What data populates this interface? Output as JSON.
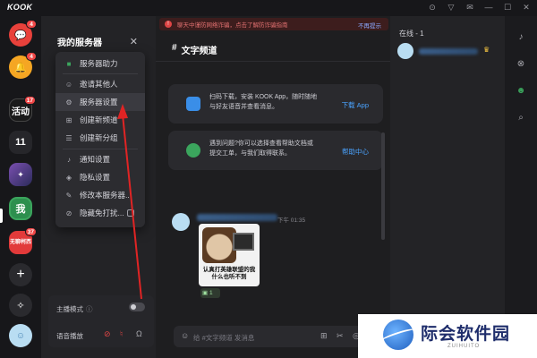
{
  "app": {
    "logo": "KOOK"
  },
  "window": {
    "controls": [
      "pin-icon",
      "shirt-icon",
      "mail-icon",
      "minimize-icon",
      "maximize-icon",
      "close-icon"
    ]
  },
  "servers": [
    {
      "icon": "chat-bubble-icon",
      "badge": "4",
      "color": "#e8413b"
    },
    {
      "icon": "bell-icon",
      "badge": "4",
      "color": "#f5a623"
    },
    {
      "label": "活动",
      "badge": "17",
      "color": "#1a1a1a"
    },
    {
      "label": "11",
      "badge": "",
      "color": "#26262a"
    },
    {
      "icon": "game-art-icon",
      "badge": "",
      "color": "#5a3d7a"
    },
    {
      "label": "我",
      "badge": "",
      "color": "#2d8f4e",
      "selected": true
    },
    {
      "label": "无聊柯西",
      "badge": "37",
      "color": "#e23a3a"
    },
    {
      "icon": "plus-icon",
      "badge": "",
      "color": "#2a2a2e"
    },
    {
      "icon": "compass-icon",
      "badge": "",
      "color": "#2a2a2e"
    }
  ],
  "sidebar": {
    "server_name": "我的服务器",
    "menu": [
      {
        "icon": "boost-icon",
        "label": "服务器助力"
      },
      {
        "icon": "invite-icon",
        "label": "邀请其他人"
      },
      {
        "icon": "settings-icon",
        "label": "服务器设置"
      },
      {
        "icon": "add-channel-icon",
        "label": "创建新频道"
      },
      {
        "icon": "add-group-icon",
        "label": "创建新分组"
      },
      {
        "icon": "bell-icon",
        "label": "通知设置"
      },
      {
        "icon": "shield-icon",
        "label": "隐私设置"
      },
      {
        "icon": "edit-icon",
        "label": "修改本服务器..."
      },
      {
        "icon": "hidden-icon",
        "label": "隐藏免打扰..."
      }
    ],
    "voice_panel": {
      "streamer_mode": "主播模式",
      "voice_connect": "语音播放"
    }
  },
  "main": {
    "notice": "聊天中谨防网络诈骗，点击了解防诈骗指南",
    "notice_dismiss": "不再提示",
    "channel_name": "文字频道",
    "cards": [
      {
        "text": "扫码下载，安装 KOOK App，随时随地与好友语音并查看消息。",
        "link": "下载 App"
      },
      {
        "text": "遇到问题?你可以选择查看帮助文档或提交工单，与我们取得联系。",
        "link": "帮助中心"
      }
    ],
    "message": {
      "time": "下午 01:35",
      "meme_text": "认真打英雄联盟的我什么也听不到",
      "reaction_count": "1"
    },
    "composer_placeholder": "给 #文字频道 发消息"
  },
  "members": {
    "online_label": "在线 - 1"
  },
  "right_bar": [
    "bell-icon",
    "mute-icon",
    "members-icon",
    "search-icon"
  ],
  "watermark": {
    "cn": "际会软件园",
    "en": "ZUIHUITO"
  },
  "colors": {
    "accent": "#4aa3ff",
    "arrow": "#e02424",
    "online": "#3ba55d"
  }
}
